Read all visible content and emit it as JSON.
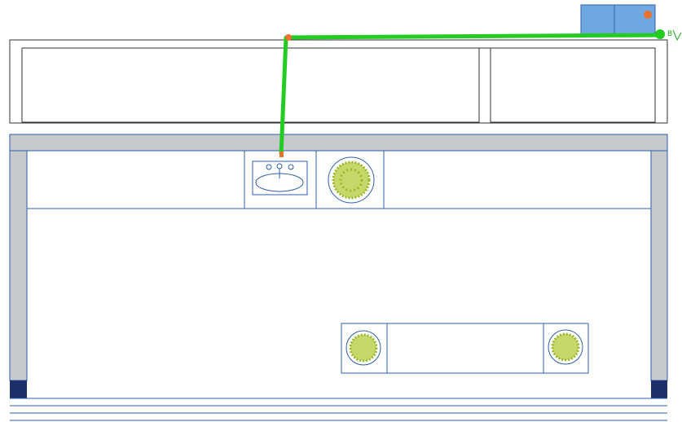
{
  "plan": {
    "pipe_label": "B",
    "colors": {
      "wall_outline": "#2f5fa8",
      "wall_fill": "#c7c9cc",
      "dark_block": "#1c2f6b",
      "pipe": "#22cc22",
      "unit_fill": "#6fa8e0",
      "marker": "#f07030",
      "plant": "#9ab82e",
      "line": "#333333"
    },
    "icons": {
      "sink": "sink-icon",
      "plant": "plant-icon",
      "appliance": "appliance-icon",
      "pipe_node": "pipe-node-icon"
    }
  }
}
